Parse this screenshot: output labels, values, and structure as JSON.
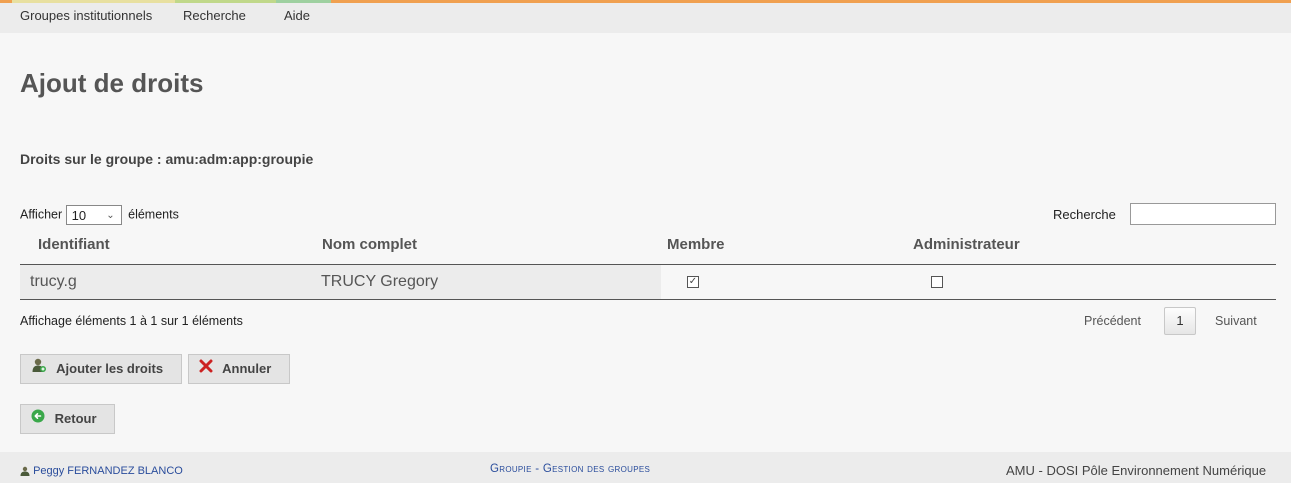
{
  "nav": {
    "tabs": [
      {
        "label": "Groupes institutionnels"
      },
      {
        "label": "Recherche"
      },
      {
        "label": "Aide"
      }
    ]
  },
  "page": {
    "title": "Ajout de droits",
    "group_rights": "Droits sur le groupe : amu:adm:app:groupie"
  },
  "table_controls": {
    "show_prefix": "Afficher",
    "page_size": "10",
    "show_suffix": "éléments",
    "search_label": "Recherche",
    "search_value": ""
  },
  "table": {
    "columns": [
      "Identifiant",
      "Nom complet",
      "Membre",
      "Administrateur"
    ],
    "rows": [
      {
        "identifiant": "trucy.g",
        "nom_complet": "TRUCY Gregory",
        "membre": true,
        "administrateur": false
      }
    ],
    "info": "Affichage éléments 1 à 1 sur 1 éléments",
    "pagination": {
      "previous": "Précédent",
      "current_page": "1",
      "next": "Suivant"
    }
  },
  "actions": {
    "add_rights": "Ajouter les droits",
    "cancel": "Annuler",
    "back": "Retour"
  },
  "footer": {
    "user": "Peggy FERNANDEZ BLANCO",
    "app": "Groupie - Gestion des groupes",
    "org": "AMU - DOSI Pôle Environnement Numérique"
  },
  "icons": {
    "add_rights": "user-add-icon",
    "cancel": "red-x-icon",
    "back": "green-back-arrow-icon",
    "user": "user-icon",
    "select": "chevron-down-icon"
  },
  "colors": {
    "accent_top": "#f0a050",
    "footer_link": "#2a4d9c",
    "cancel_icon": "#cc2222",
    "back_icon": "#3aa84a"
  }
}
